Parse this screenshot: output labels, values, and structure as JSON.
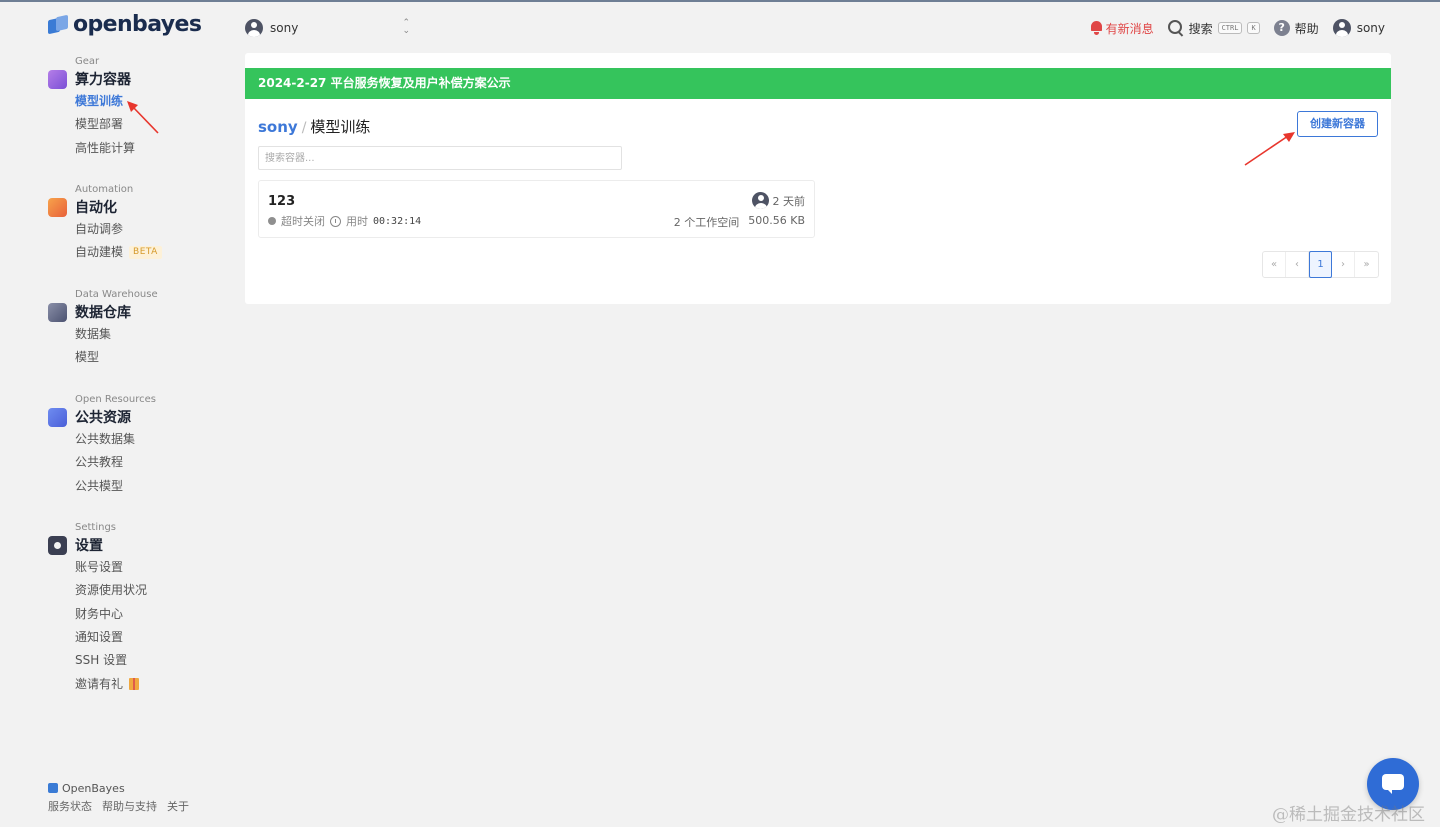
{
  "brand": {
    "name": "openbayes"
  },
  "sidebar": {
    "sections": [
      {
        "category": "Gear",
        "title": "算力容器",
        "items": [
          {
            "label": "模型训练",
            "active": true
          },
          {
            "label": "模型部署"
          },
          {
            "label": "高性能计算"
          }
        ]
      },
      {
        "category": "Automation",
        "title": "自动化",
        "items": [
          {
            "label": "自动调参"
          },
          {
            "label": "自动建模",
            "badge": "BETA"
          }
        ]
      },
      {
        "category": "Data Warehouse",
        "title": "数据仓库",
        "items": [
          {
            "label": "数据集"
          },
          {
            "label": "模型"
          }
        ]
      },
      {
        "category": "Open Resources",
        "title": "公共资源",
        "items": [
          {
            "label": "公共数据集"
          },
          {
            "label": "公共教程"
          },
          {
            "label": "公共模型"
          }
        ]
      },
      {
        "category": "Settings",
        "title": "设置",
        "items": [
          {
            "label": "账号设置"
          },
          {
            "label": "资源使用状况"
          },
          {
            "label": "财务中心"
          },
          {
            "label": "通知设置"
          },
          {
            "label": "SSH 设置"
          },
          {
            "label": "邀请有礼"
          }
        ]
      }
    ],
    "footer": {
      "brand": "OpenBayes",
      "links": [
        "服务状态",
        "帮助与支持",
        "关于"
      ]
    }
  },
  "topbar": {
    "workspace_user": "sony",
    "notify_label": "有新消息",
    "search_label": "搜索",
    "shortcut_keys": [
      "CTRL",
      "K"
    ],
    "help_label": "帮助",
    "current_user": "sony"
  },
  "main": {
    "announcement": "2024-2-27 平台服务恢复及用户补偿方案公示",
    "breadcrumb": {
      "root": "sony",
      "separator": "/",
      "current": "模型训练"
    },
    "create_button": "创建新容器",
    "search_placeholder": "搜索容器...",
    "containers": [
      {
        "name": "123",
        "status": "超时关闭",
        "runtime_label": "用时",
        "runtime": "00:32:14",
        "age": "2 天前",
        "workspaces": "2 个工作空间",
        "size": "500.56 KB"
      }
    ],
    "pagination": [
      "«",
      "‹",
      "1",
      "›",
      "»"
    ],
    "current_page": "1"
  },
  "watermark": "@稀土掘金技术社区",
  "colors": {
    "accent": "#3d78d8",
    "banner": "#35c45c",
    "notify": "#e04646",
    "arrow": "#e8362d"
  }
}
